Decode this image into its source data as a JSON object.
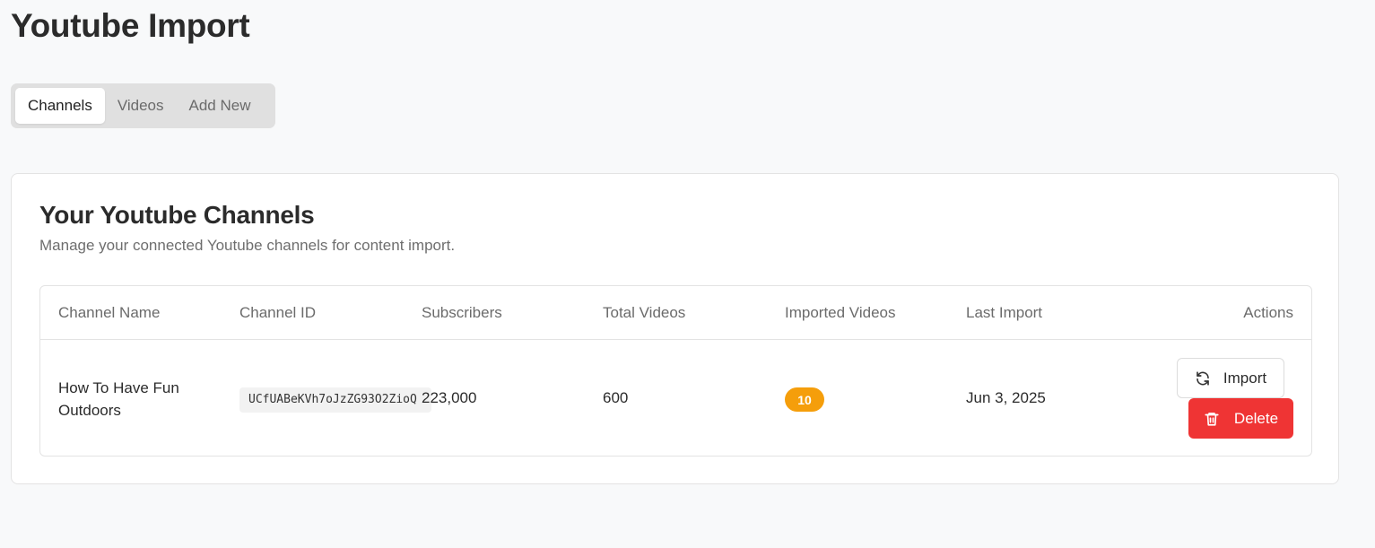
{
  "page": {
    "title": "Youtube Import"
  },
  "tabs": [
    {
      "label": "Channels",
      "active": true
    },
    {
      "label": "Videos",
      "active": false
    },
    {
      "label": "Add New",
      "active": false
    }
  ],
  "card": {
    "title": "Your Youtube Channels",
    "subtitle": "Manage your connected Youtube channels for content import."
  },
  "table": {
    "headers": [
      "Channel Name",
      "Channel ID",
      "Subscribers",
      "Total Videos",
      "Imported Videos",
      "Last Import",
      "Actions"
    ],
    "rows": [
      {
        "channel_name": "How To Have Fun Outdoors",
        "channel_id": "UCfUABeKVh7oJzZG93O2ZioQ",
        "subscribers": "223,000",
        "total_videos": "600",
        "imported_videos": "10",
        "last_import": "Jun 3, 2025",
        "import_label": "Import",
        "delete_label": "Delete"
      }
    ]
  },
  "colors": {
    "badge": "#f59e0b",
    "delete": "#ef3434",
    "background": "#f8f9fa"
  },
  "icons": {
    "import": "refresh-icon",
    "delete": "trash-icon"
  }
}
